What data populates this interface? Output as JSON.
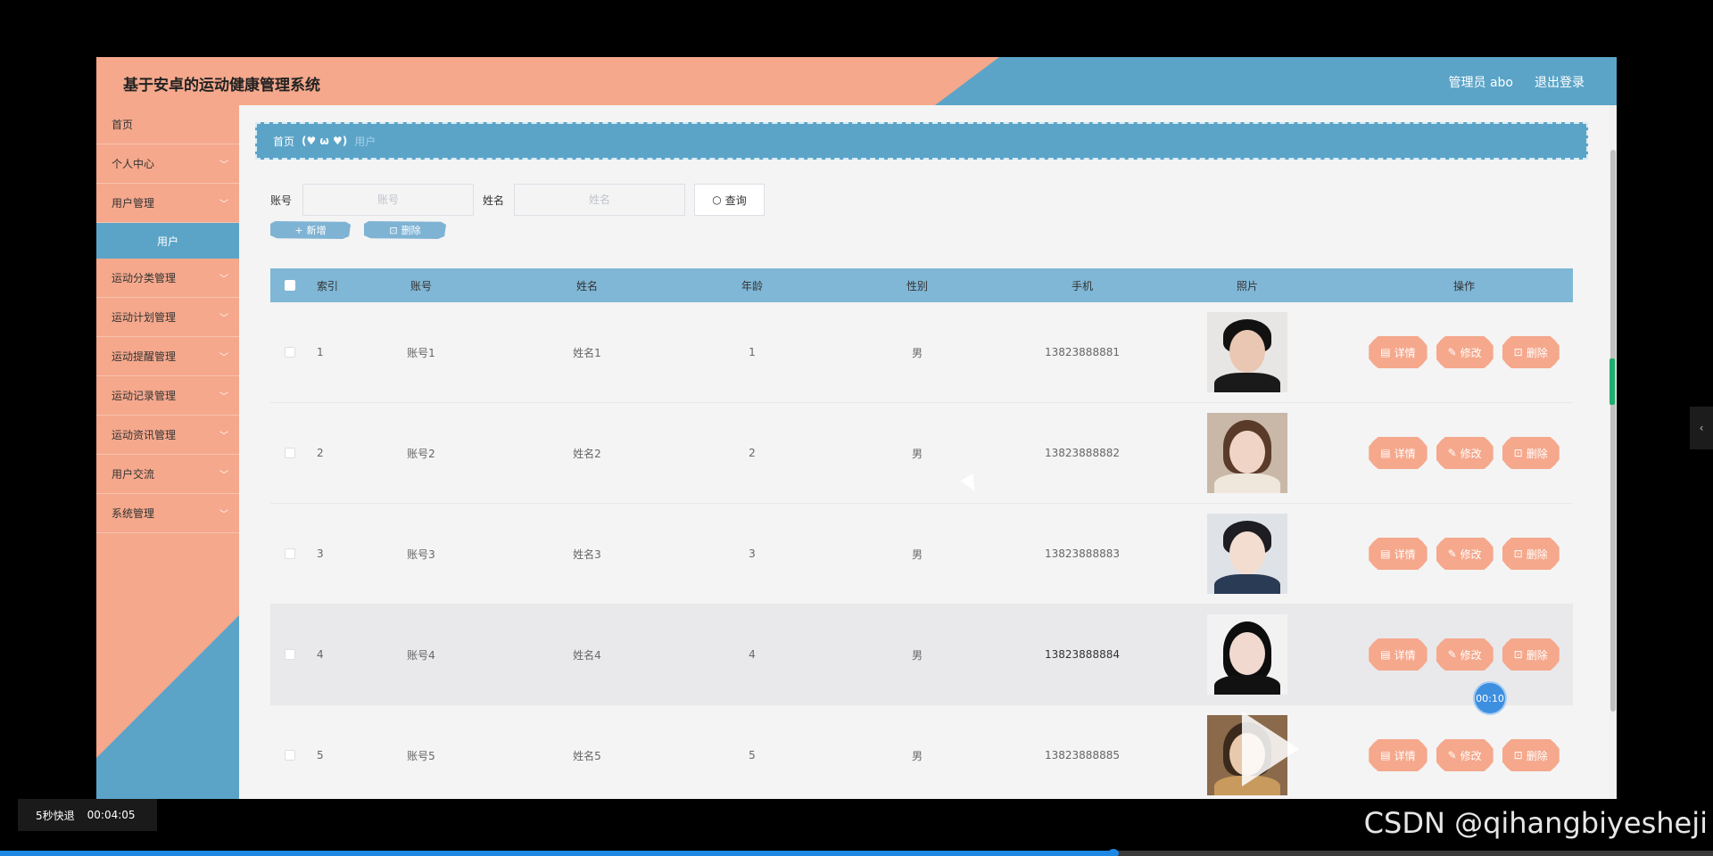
{
  "header": {
    "title": "基于安卓的运动健康管理系统",
    "user": "管理员 abo",
    "logout": "退出登录"
  },
  "sidebar": {
    "items": [
      {
        "label": "首页"
      },
      {
        "label": "个人中心"
      },
      {
        "label": "用户管理"
      },
      {
        "label": "运动分类管理"
      },
      {
        "label": "运动计划管理"
      },
      {
        "label": "运动提醒管理"
      },
      {
        "label": "运动记录管理"
      },
      {
        "label": "运动资讯管理"
      },
      {
        "label": "用户交流"
      },
      {
        "label": "系统管理"
      }
    ],
    "sub_item": "用户"
  },
  "breadcrumb": {
    "home": "首页",
    "face": "(♥ ω ♥)",
    "current": "用户"
  },
  "search": {
    "account_label": "账号",
    "account_placeholder": "账号",
    "name_label": "姓名",
    "name_placeholder": "姓名",
    "button": "查询"
  },
  "actions": {
    "add": "新增",
    "delete": "删除"
  },
  "table": {
    "headers": [
      "索引",
      "账号",
      "姓名",
      "年龄",
      "性别",
      "手机",
      "照片",
      "操作"
    ],
    "rows": [
      {
        "index": "1",
        "account": "账号1",
        "name": "姓名1",
        "age": "1",
        "gender": "男",
        "phone": "13823888881"
      },
      {
        "index": "2",
        "account": "账号2",
        "name": "姓名2",
        "age": "2",
        "gender": "男",
        "phone": "13823888882"
      },
      {
        "index": "3",
        "account": "账号3",
        "name": "姓名3",
        "age": "3",
        "gender": "男",
        "phone": "13823888883"
      },
      {
        "index": "4",
        "account": "账号4",
        "name": "姓名4",
        "age": "4",
        "gender": "男",
        "phone": "13823888884"
      },
      {
        "index": "5",
        "account": "账号5",
        "name": "姓名5",
        "age": "5",
        "gender": "男",
        "phone": "13823888885"
      }
    ],
    "ops": {
      "detail": "详情",
      "edit": "修改",
      "delete": "删除"
    }
  },
  "player": {
    "rewind": "5秒快退",
    "time": "00:04:05",
    "timer": "00:10",
    "progress": 0.65
  },
  "watermark": "CSDN @qihangbiyesheji",
  "colors": {
    "salmon": "#f5a88c",
    "blue": "#5ba4c8",
    "table_header": "#80b7d6"
  }
}
